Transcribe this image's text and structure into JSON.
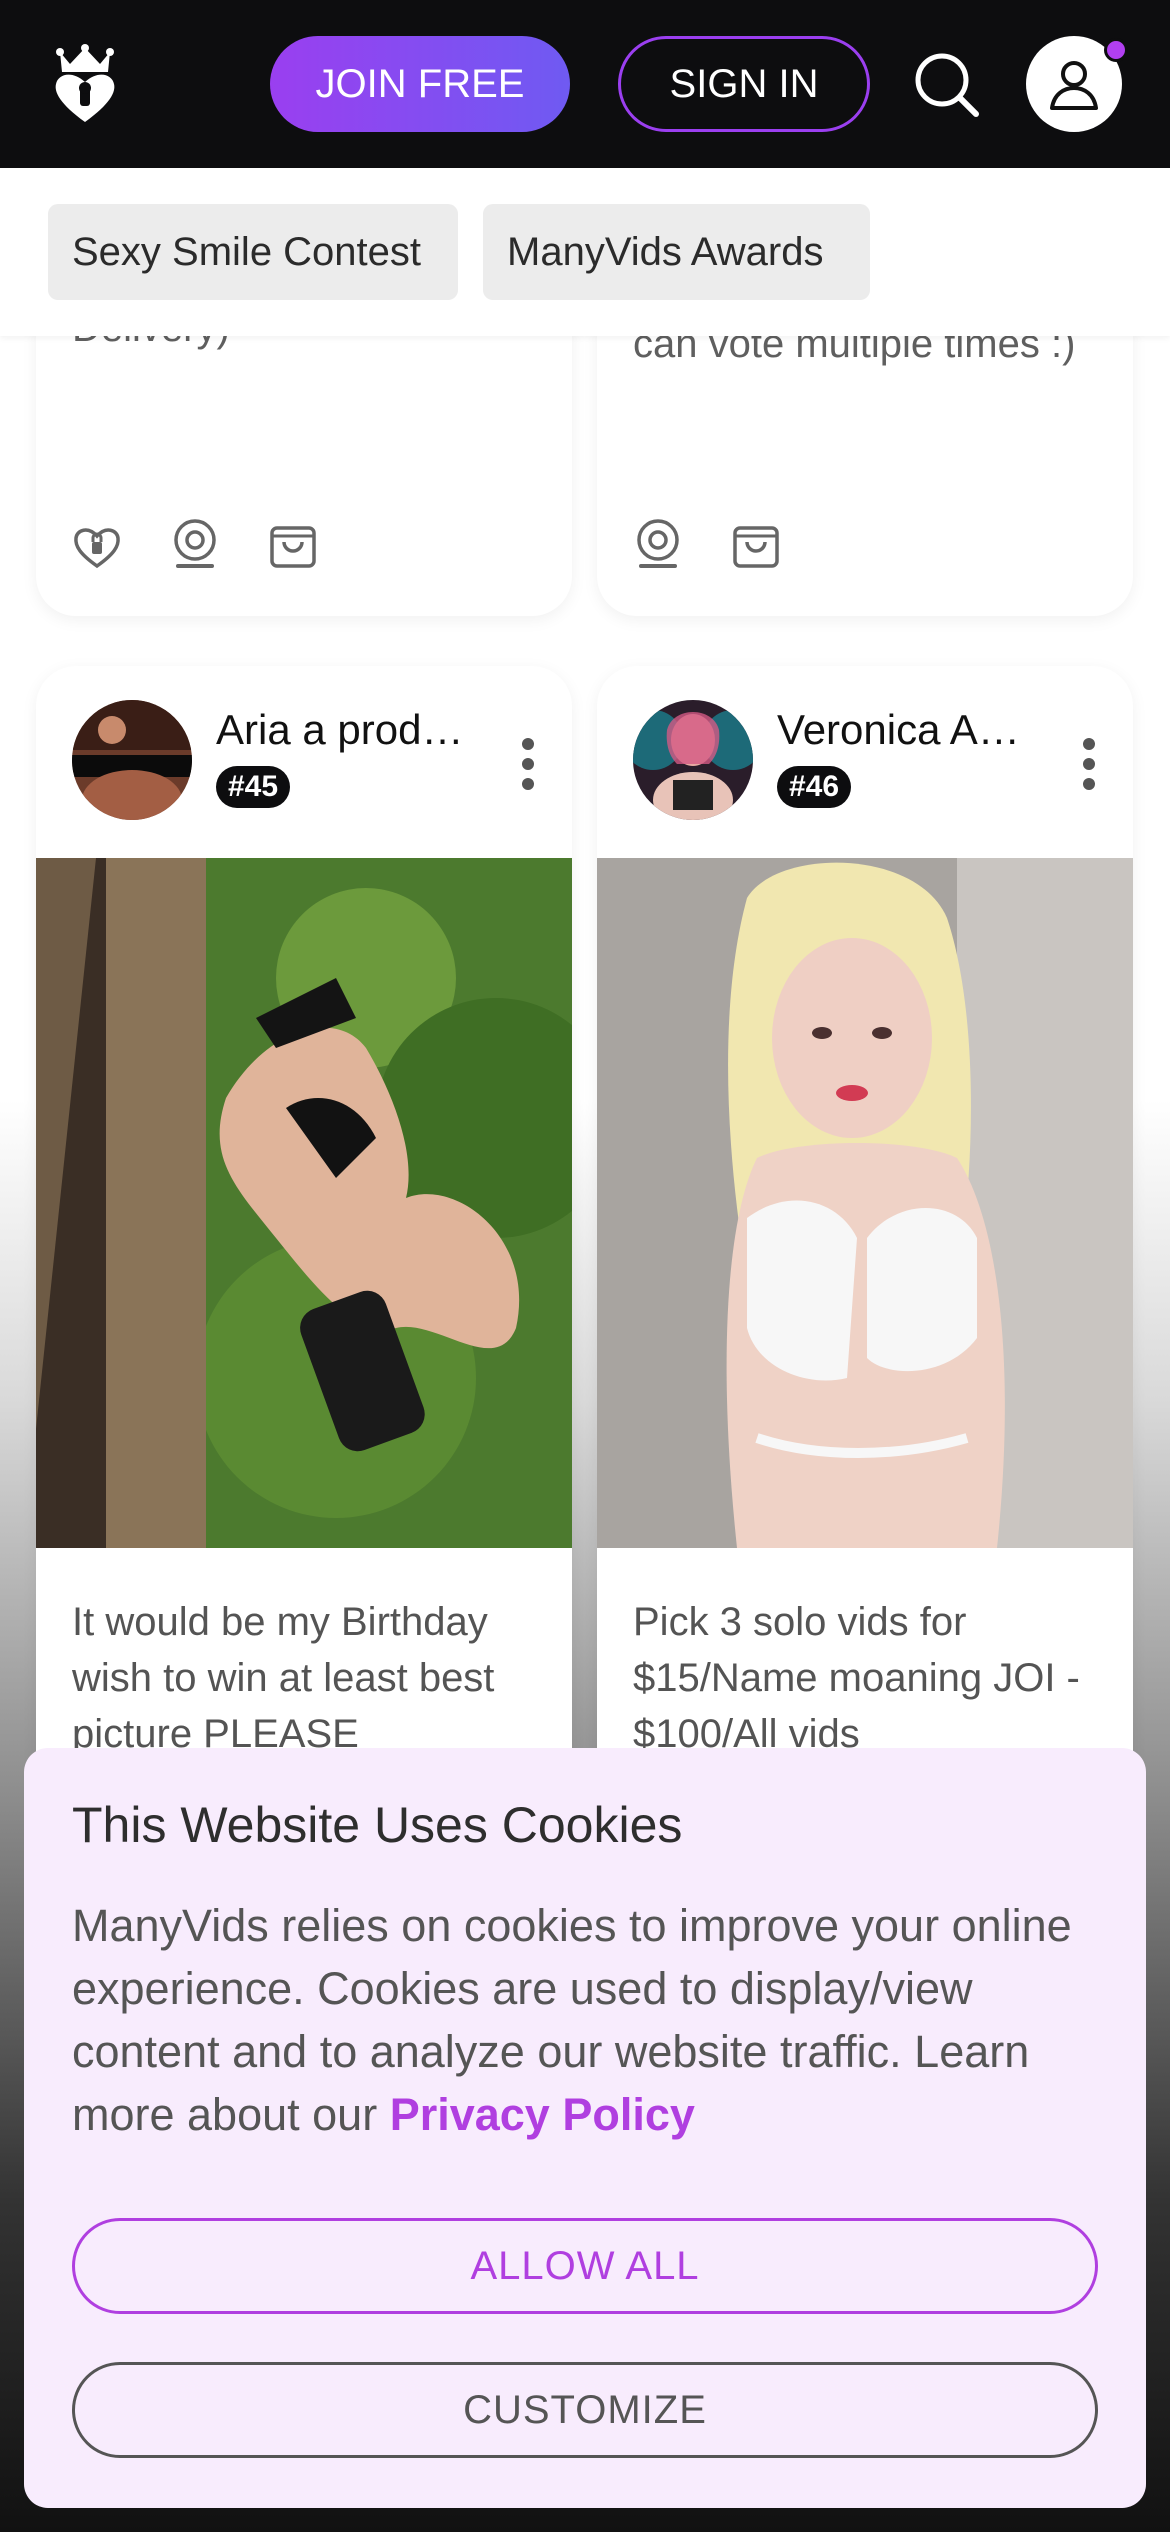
{
  "header": {
    "logo_icon": "crown-heart-logo-icon",
    "join_label": "JOIN FREE",
    "signin_label": "SIGN IN",
    "search_icon": "search-icon",
    "account_icon": "user-icon",
    "accent_color": "#9a3ff0"
  },
  "tags": [
    {
      "label": "Sexy Smile Contest"
    },
    {
      "label": "ManyVids Awards"
    }
  ],
  "top_cards": [
    {
      "description": "Delivery)",
      "icons": [
        "lock-heart-icon",
        "webcam-icon",
        "shopping-bag-icon"
      ]
    },
    {
      "description": "vids msg me after u vote, can vote multiple times :)",
      "icons": [
        "webcam-icon",
        "shopping-bag-icon"
      ]
    }
  ],
  "cards": [
    {
      "name": "Aria a prod…",
      "rank": "#45",
      "description": "It would be my Birthday wish to win at least best picture PLEASE"
    },
    {
      "name": "Veronica A…",
      "rank": "#46",
      "description": "Pick 3 solo vids for $15/Name moaning JOI - $100/All vids"
    }
  ],
  "cookie": {
    "title": "This Website Uses Cookies",
    "text": "ManyVids relies on cookies to improve your online experience. Cookies are used to display/view content and to analyze our website traffic. Learn more about our ",
    "link_label": "Privacy Policy",
    "allow_label": "ALLOW ALL",
    "customize_label": "CUSTOMIZE"
  }
}
